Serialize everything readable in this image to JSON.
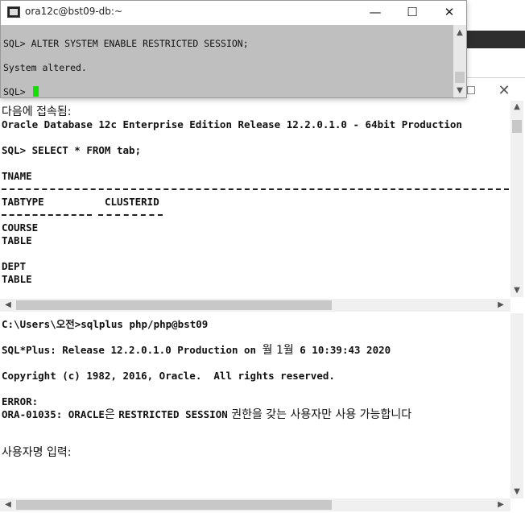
{
  "top_window": {
    "title": "ora12c@bst09-db:~",
    "minimize": "—",
    "maximize": "☐",
    "close": "✕",
    "lines": [
      "SQL> ALTER SYSTEM ENABLE RESTRICTED SESSION;",
      "System altered.",
      "SQL> "
    ]
  },
  "back_window": {
    "close": "✕",
    "upper_pane": {
      "connected_label": "다음에 접속됨:",
      "version_line": "Oracle Database 12c Enterprise Edition Release 12.2.0.1.0 - 64bit Production",
      "query": "SQL> SELECT * FROM tab;",
      "col_tname": "TNAME",
      "col_tabtype": "TABTYPE",
      "col_clusterid": "CLUSTERID",
      "rows": [
        {
          "tname": "COURSE",
          "tabtype": "TABLE"
        },
        {
          "tname": "DEPT",
          "tabtype": "TABLE"
        }
      ]
    },
    "lower_pane": {
      "command_prefix": "C:\\Users\\오전>",
      "command": "sqlplus php/php@bst09",
      "banner_prefix": "SQL*Plus: Release 12.2.0.1.0 Production on ",
      "banner_date_kr": "월 1월",
      "banner_suffix": " 6 10:39:43 2020",
      "copyright": "Copyright (c) 1982, 2016, Oracle.  All rights reserved.",
      "error_label": "ERROR:",
      "error_code": "ORA-01035: ORACLE",
      "error_msg_kr": "은 ",
      "error_mid": "RESTRICTED SESSION",
      "error_tail_kr": " 권한을 갖는 사용자만 사용 가능합니다",
      "username_prompt": "사용자명 입력:"
    }
  },
  "colors": {
    "cursor": "#13e000",
    "top_console_bg": "#bfbfbf"
  }
}
